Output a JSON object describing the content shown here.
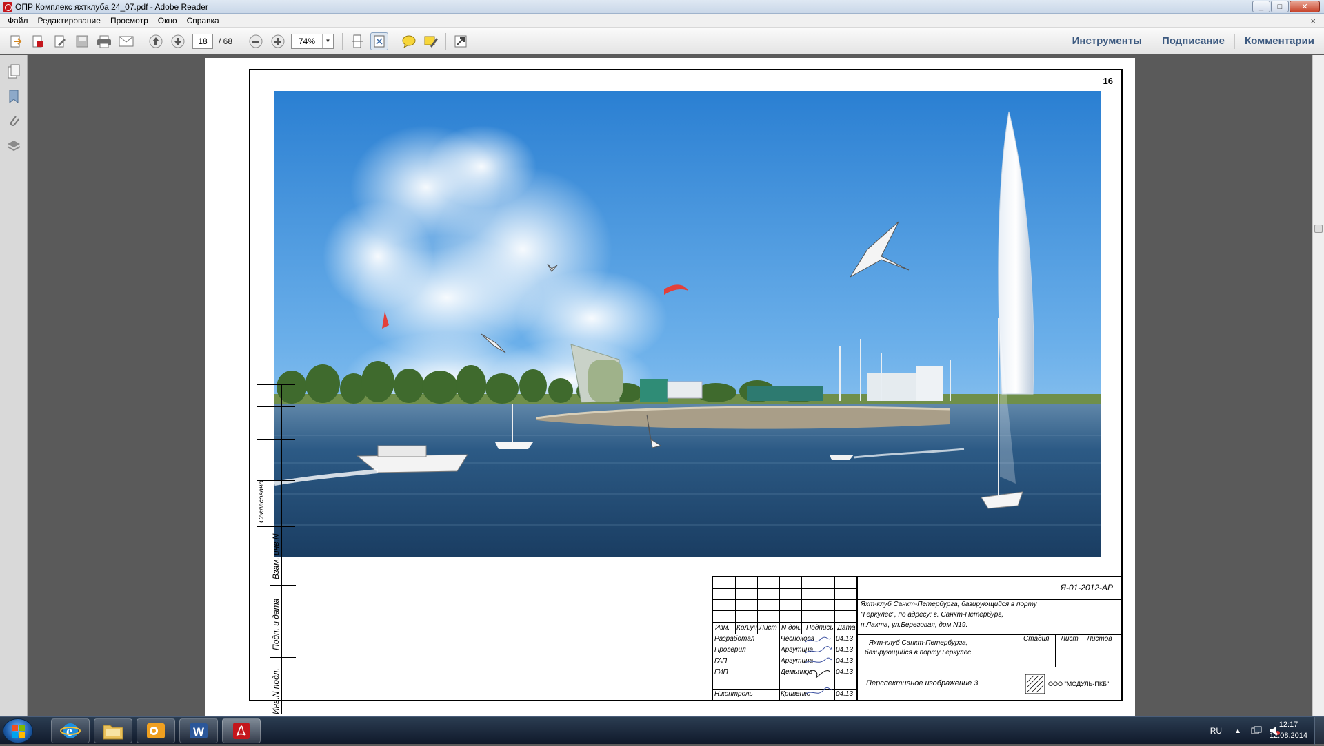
{
  "window": {
    "title": "ОПР Комплекс яхтклуба 24_07.pdf - Adobe Reader"
  },
  "menu": {
    "items": [
      "Файл",
      "Редактирование",
      "Просмотр",
      "Окно",
      "Справка"
    ],
    "close_glyph": "×"
  },
  "toolbar": {
    "page_current": "18",
    "page_total": "/ 68",
    "zoom": "74%"
  },
  "right_links": [
    "Инструменты",
    "Подписание",
    "Комментарии"
  ],
  "page": {
    "sheet_number": "16"
  },
  "stamp": {
    "doc_code": "Я-01-2012-АР",
    "project_desc": "Яхт-клуб Санкт-Петербурга, базирующийся в порту \"Геркулес\", по адресу: г. Санкт-Петербург, п.Лахта, ул.Береговая, дом N19.",
    "project_desc_lines": [
      "Яхт-клуб Санкт-Петербурга, базирующийся в порту",
      "\"Геркулес\", по адресу: г. Санкт-Петербург,",
      "п.Лахта, ул.Береговая, дом N19."
    ],
    "short_desc_lines": [
      "Яхт-клуб Санкт-Петербурга,",
      "базирующийся в порту Геркулес"
    ],
    "sheet_title": "Перспективное изображение 3",
    "company": "ООО \"МОДУЛЬ-ПКБ\"",
    "headers": [
      "Изм.",
      "Кол.уч.",
      "Лист",
      "N док.",
      "Подпись",
      "Дата"
    ],
    "stage_headers": [
      "Стадия",
      "Лист",
      "Листов"
    ],
    "people": [
      {
        "role": "Разработал",
        "name": "Чеснокова",
        "date": "04.13"
      },
      {
        "role": "Проверил",
        "name": "Аргутина",
        "date": "04.13"
      },
      {
        "role": "ГАП",
        "name": "Аргутина",
        "date": "04.13"
      },
      {
        "role": "ГИП",
        "name": "Демьянов",
        "date": "04.13"
      },
      {
        "role": "Н.контроль",
        "name": "Кривенко",
        "date": "04.13"
      }
    ]
  },
  "side_stamp": {
    "labels": [
      "Инв.N подл.",
      "Подп. и дата",
      "Взам. инв.N",
      "Согласовано"
    ]
  },
  "taskbar": {
    "lang": "RU",
    "time": "12:17",
    "date": "12.08.2014"
  },
  "colors": {
    "pdf_red": "#c4161c",
    "link_blue": "#3d5a80",
    "sky_top": "#2f86d6",
    "water": "#1f4e78"
  }
}
